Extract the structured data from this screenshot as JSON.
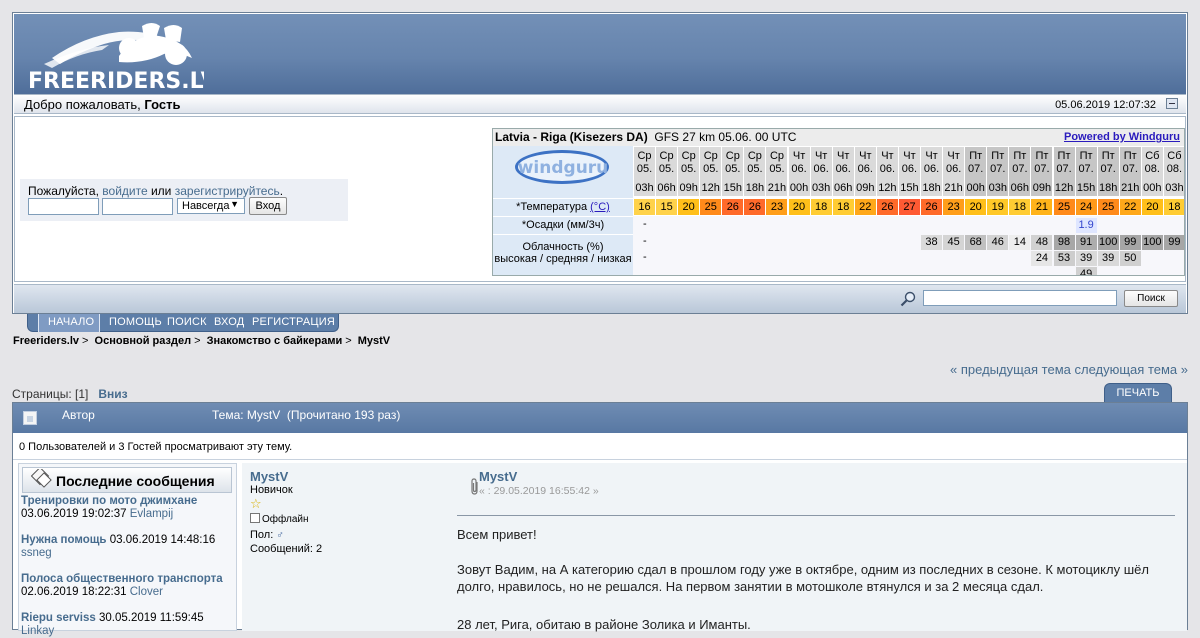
{
  "header": {
    "site_logo_text": "FREERIDERS.LV",
    "welcome_prefix": "Добро пожаловать, ",
    "welcome_user": "Гость",
    "datetime": "05.06.2019 12:07:32"
  },
  "login": {
    "please": "Пожалуйста, ",
    "login_link": "войдите",
    "or": " или ",
    "register_link": "зарегистрируйтесь",
    "dot": ".",
    "username_value": "",
    "password_value": "",
    "duration_select": "Навсегда",
    "login_button": "Вход"
  },
  "windguru": {
    "location": "Latvia - Riga (Kisezers DA)",
    "model": "GFS 27 km 05.06. 00 UTC",
    "powered": "Powered by Windguru",
    "logo_text": "windguru",
    "temp_label": "*Температура",
    "temp_unit": "(°C)",
    "precip_label": "*Осадки (мм/3ч)",
    "cloud_label": "Облачность (%)",
    "cloud_sublabel": "высокая / средняя / низкая",
    "days": [
      "Ср",
      "Ср",
      "Ср",
      "Ср",
      "Ср",
      "Ср",
      "Ср",
      "Чт",
      "Чт",
      "Чт",
      "Чт",
      "Чт",
      "Чт",
      "Чт",
      "Чт",
      "Пт",
      "Пт",
      "Пт",
      "Пт",
      "Пт",
      "Пт",
      "Пт",
      "Пт",
      "Сб",
      "Сб"
    ],
    "dates": [
      "05.",
      "05.",
      "05.",
      "05.",
      "05.",
      "05.",
      "05.",
      "06.",
      "06.",
      "06.",
      "06.",
      "06.",
      "06.",
      "06.",
      "06.",
      "07.",
      "07.",
      "07.",
      "07.",
      "07.",
      "07.",
      "07.",
      "07.",
      "08.",
      "08."
    ],
    "hours": [
      "03h",
      "06h",
      "09h",
      "12h",
      "15h",
      "18h",
      "21h",
      "00h",
      "03h",
      "06h",
      "09h",
      "12h",
      "15h",
      "18h",
      "21h",
      "00h",
      "03h",
      "06h",
      "09h",
      "12h",
      "15h",
      "18h",
      "21h",
      "00h",
      "03h"
    ],
    "temps": [
      "16",
      "15",
      "20",
      "25",
      "26",
      "26",
      "23",
      "20",
      "18",
      "18",
      "22",
      "26",
      "27",
      "26",
      "23",
      "20",
      "19",
      "18",
      "21",
      "25",
      "24",
      "25",
      "22",
      "20",
      "18"
    ],
    "temp_colors": [
      "#ffd24a",
      "#ffd24a",
      "#ffbf1a",
      "#ff8a1a",
      "#ff6a2a",
      "#ff6a2a",
      "#ff9e1a",
      "#ffbf1a",
      "#ffcc33",
      "#ffcc33",
      "#ffa81a",
      "#ff6a2a",
      "#ff5a33",
      "#ff6a2a",
      "#ff9e1a",
      "#ffbf1a",
      "#ffc828",
      "#ffcc33",
      "#ffb31a",
      "#ff8a1a",
      "#ff9a1a",
      "#ff8a1a",
      "#ffa81a",
      "#ffbf1a",
      "#ffcc33"
    ],
    "precip_dash": "-",
    "precip": [
      {
        "col": 20,
        "value": "1.9"
      }
    ],
    "cloud_dash": "-",
    "cloud_high": [
      {
        "col": 13,
        "value": "38"
      },
      {
        "col": 14,
        "value": "45"
      },
      {
        "col": 15,
        "value": "68"
      },
      {
        "col": 16,
        "value": "46"
      },
      {
        "col": 17,
        "value": "14"
      },
      {
        "col": 18,
        "value": "48"
      },
      {
        "col": 19,
        "value": "98"
      },
      {
        "col": 20,
        "value": "91"
      },
      {
        "col": 21,
        "value": "100"
      },
      {
        "col": 22,
        "value": "99"
      },
      {
        "col": 23,
        "value": "100"
      },
      {
        "col": 24,
        "value": "99"
      }
    ],
    "cloud_mid": [
      {
        "col": 18,
        "value": "24"
      },
      {
        "col": 19,
        "value": "53"
      },
      {
        "col": 20,
        "value": "39"
      },
      {
        "col": 21,
        "value": "39"
      },
      {
        "col": 22,
        "value": "50"
      }
    ],
    "cloud_low": [
      {
        "col": 20,
        "value": "49"
      }
    ]
  },
  "search": {
    "query_value": "",
    "button": "Поиск"
  },
  "nav": {
    "items": [
      "НАЧАЛО",
      "ПОМОЩЬ",
      "ПОИСК",
      "ВХОД",
      "РЕГИСТРАЦИЯ"
    ]
  },
  "breadcrumbs": [
    "Freeriders.lv",
    "Основной раздел",
    "Знакомство с байкерами",
    "MystV"
  ],
  "breadcrumb_sep": ">",
  "topic_nav": {
    "prev": "« предыдущая тема",
    "next": "следующая тема »",
    "pages_label": "Страницы: [",
    "current_page": "1",
    "pages_close": "]",
    "down": "Вниз",
    "print": "ПЕЧАТЬ"
  },
  "topic": {
    "author_col": "Автор",
    "title": "Тема: MystV  (Прочитано 193 раз)",
    "viewers": "0 Пользователей и 3 Гостей просматривают эту тему."
  },
  "recent": {
    "title": "Последние сообщения",
    "items": [
      {
        "topic": "Тренировки по мото джимхане",
        "date": "03.06.2019 19:02:37",
        "author": "Evlampij"
      },
      {
        "topic": "Нужна помощь",
        "date": "03.06.2019 14:48:16",
        "author": "ssneg"
      },
      {
        "topic": "Полоса общественного транспорта",
        "date": "02.06.2019 18:22:31",
        "author": "Clover"
      },
      {
        "topic": "Riepu serviss",
        "date": "30.05.2019 11:59:45",
        "author": "Linkay"
      }
    ]
  },
  "post": {
    "author": "MystV",
    "rank": "Новичок",
    "status": "Оффлайн",
    "gender_label": "Пол: ",
    "posts": "Сообщений: 2",
    "title": "MystV",
    "date": "« : 29.05.2019 16:55:42 »",
    "paragraphs": [
      "Всем привет!",
      "Зовут Вадим, на А категорию сдал в прошлом году уже в октябре, одним из последних в сезоне. К мотоциклу шёл долго, нравилось, но не решался. На первом занятии в мотошколе втянулся и за 2 месяца сдал.",
      "28 лет, Рига, обитаю в районе Золика и Иманты."
    ]
  }
}
